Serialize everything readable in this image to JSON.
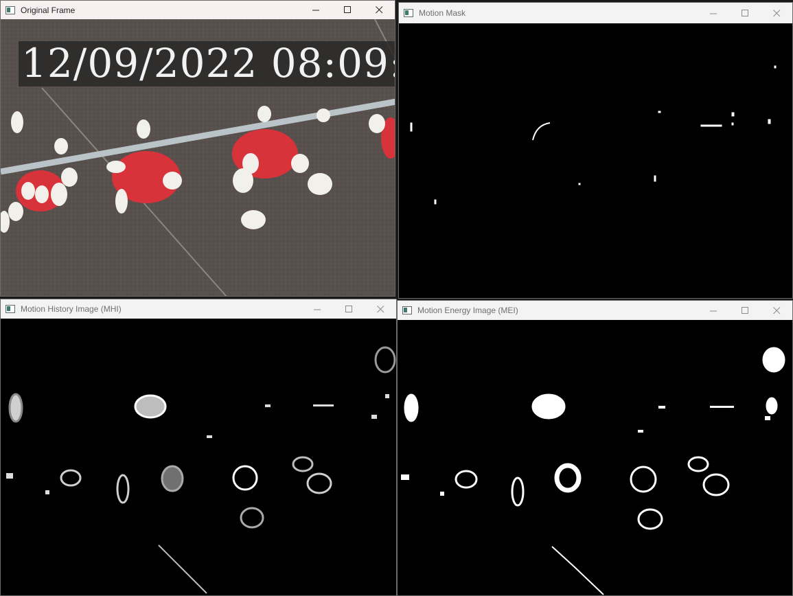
{
  "windows": {
    "original": {
      "title": "Original Frame",
      "timestamp": "12/09/2022 08:09:"
    },
    "mask": {
      "title": "Motion Mask"
    },
    "mhi": {
      "title": "Motion History Image (MHI)"
    },
    "mei": {
      "title": "Motion Energy Image (MEI)"
    }
  },
  "colors": {
    "floor": "#5a5350",
    "feeder_red": "#d8323a",
    "chick": "#f2f0ea",
    "pipe": "#b9c3c8"
  },
  "icons": {
    "minimize": "minimize-icon",
    "maximize": "maximize-icon",
    "close": "close-icon",
    "app": "opencv-window-icon"
  }
}
